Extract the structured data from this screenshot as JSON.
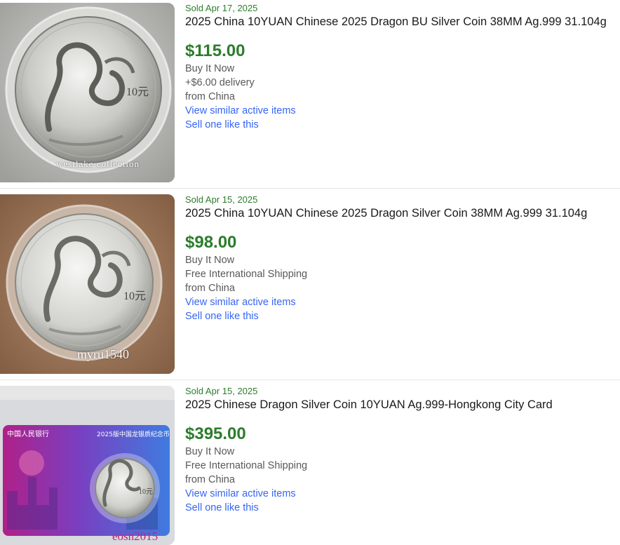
{
  "listings": [
    {
      "sold_date": "Sold Apr 17, 2025",
      "title": "2025 China 10YUAN Chinese 2025 Dragon BU Silver Coin 38MM Ag.999 31.104g",
      "price": "$115.00",
      "format": "Buy It Now",
      "shipping": "+$6.00 delivery",
      "location": "from China",
      "view_similar": "View similar active items",
      "sell_one": "Sell one like this",
      "watermark": "westlake collection"
    },
    {
      "sold_date": "Sold Apr 15, 2025",
      "title": "2025 China 10YUAN Chinese 2025 Dragon Silver Coin 38MM Ag.999 31.104g",
      "price": "$98.00",
      "format": "Buy It Now",
      "shipping": "Free International Shipping",
      "location": "from China",
      "view_similar": "View similar active items",
      "sell_one": "Sell one like this",
      "watermark": "myru1540"
    },
    {
      "sold_date": "Sold Apr 15, 2025",
      "title": "2025 Chinese Dragon Silver Coin 10YUAN Ag.999-Hongkong City Card",
      "price": "$395.00",
      "format": "Buy It Now",
      "shipping": "Free International Shipping",
      "location": "from China",
      "view_similar": "View similar active items",
      "sell_one": "Sell one like this",
      "watermark": "eosn2015",
      "card_header": "2025版中国龙银质纪念币"
    }
  ],
  "colors": {
    "sold_green": "#2c7d2c",
    "link_blue": "#3665f3",
    "title_text": "#191919",
    "meta_text": "#595959"
  }
}
